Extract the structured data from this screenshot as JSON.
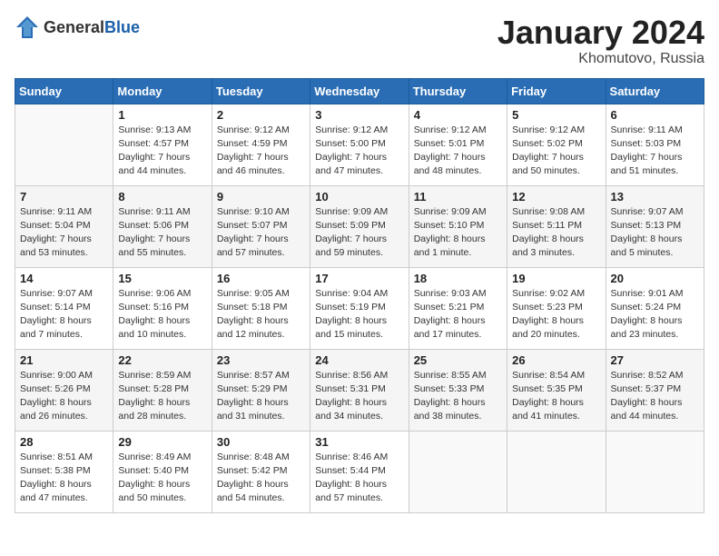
{
  "header": {
    "logo_general": "General",
    "logo_blue": "Blue",
    "title": "January 2024",
    "subtitle": "Khomutovo, Russia"
  },
  "weekdays": [
    "Sunday",
    "Monday",
    "Tuesday",
    "Wednesday",
    "Thursday",
    "Friday",
    "Saturday"
  ],
  "weeks": [
    [
      {
        "day": "",
        "info": ""
      },
      {
        "day": "1",
        "info": "Sunrise: 9:13 AM\nSunset: 4:57 PM\nDaylight: 7 hours\nand 44 minutes."
      },
      {
        "day": "2",
        "info": "Sunrise: 9:12 AM\nSunset: 4:59 PM\nDaylight: 7 hours\nand 46 minutes."
      },
      {
        "day": "3",
        "info": "Sunrise: 9:12 AM\nSunset: 5:00 PM\nDaylight: 7 hours\nand 47 minutes."
      },
      {
        "day": "4",
        "info": "Sunrise: 9:12 AM\nSunset: 5:01 PM\nDaylight: 7 hours\nand 48 minutes."
      },
      {
        "day": "5",
        "info": "Sunrise: 9:12 AM\nSunset: 5:02 PM\nDaylight: 7 hours\nand 50 minutes."
      },
      {
        "day": "6",
        "info": "Sunrise: 9:11 AM\nSunset: 5:03 PM\nDaylight: 7 hours\nand 51 minutes."
      }
    ],
    [
      {
        "day": "7",
        "info": "Sunrise: 9:11 AM\nSunset: 5:04 PM\nDaylight: 7 hours\nand 53 minutes."
      },
      {
        "day": "8",
        "info": "Sunrise: 9:11 AM\nSunset: 5:06 PM\nDaylight: 7 hours\nand 55 minutes."
      },
      {
        "day": "9",
        "info": "Sunrise: 9:10 AM\nSunset: 5:07 PM\nDaylight: 7 hours\nand 57 minutes."
      },
      {
        "day": "10",
        "info": "Sunrise: 9:09 AM\nSunset: 5:09 PM\nDaylight: 7 hours\nand 59 minutes."
      },
      {
        "day": "11",
        "info": "Sunrise: 9:09 AM\nSunset: 5:10 PM\nDaylight: 8 hours\nand 1 minute."
      },
      {
        "day": "12",
        "info": "Sunrise: 9:08 AM\nSunset: 5:11 PM\nDaylight: 8 hours\nand 3 minutes."
      },
      {
        "day": "13",
        "info": "Sunrise: 9:07 AM\nSunset: 5:13 PM\nDaylight: 8 hours\nand 5 minutes."
      }
    ],
    [
      {
        "day": "14",
        "info": "Sunrise: 9:07 AM\nSunset: 5:14 PM\nDaylight: 8 hours\nand 7 minutes."
      },
      {
        "day": "15",
        "info": "Sunrise: 9:06 AM\nSunset: 5:16 PM\nDaylight: 8 hours\nand 10 minutes."
      },
      {
        "day": "16",
        "info": "Sunrise: 9:05 AM\nSunset: 5:18 PM\nDaylight: 8 hours\nand 12 minutes."
      },
      {
        "day": "17",
        "info": "Sunrise: 9:04 AM\nSunset: 5:19 PM\nDaylight: 8 hours\nand 15 minutes."
      },
      {
        "day": "18",
        "info": "Sunrise: 9:03 AM\nSunset: 5:21 PM\nDaylight: 8 hours\nand 17 minutes."
      },
      {
        "day": "19",
        "info": "Sunrise: 9:02 AM\nSunset: 5:23 PM\nDaylight: 8 hours\nand 20 minutes."
      },
      {
        "day": "20",
        "info": "Sunrise: 9:01 AM\nSunset: 5:24 PM\nDaylight: 8 hours\nand 23 minutes."
      }
    ],
    [
      {
        "day": "21",
        "info": "Sunrise: 9:00 AM\nSunset: 5:26 PM\nDaylight: 8 hours\nand 26 minutes."
      },
      {
        "day": "22",
        "info": "Sunrise: 8:59 AM\nSunset: 5:28 PM\nDaylight: 8 hours\nand 28 minutes."
      },
      {
        "day": "23",
        "info": "Sunrise: 8:57 AM\nSunset: 5:29 PM\nDaylight: 8 hours\nand 31 minutes."
      },
      {
        "day": "24",
        "info": "Sunrise: 8:56 AM\nSunset: 5:31 PM\nDaylight: 8 hours\nand 34 minutes."
      },
      {
        "day": "25",
        "info": "Sunrise: 8:55 AM\nSunset: 5:33 PM\nDaylight: 8 hours\nand 38 minutes."
      },
      {
        "day": "26",
        "info": "Sunrise: 8:54 AM\nSunset: 5:35 PM\nDaylight: 8 hours\nand 41 minutes."
      },
      {
        "day": "27",
        "info": "Sunrise: 8:52 AM\nSunset: 5:37 PM\nDaylight: 8 hours\nand 44 minutes."
      }
    ],
    [
      {
        "day": "28",
        "info": "Sunrise: 8:51 AM\nSunset: 5:38 PM\nDaylight: 8 hours\nand 47 minutes."
      },
      {
        "day": "29",
        "info": "Sunrise: 8:49 AM\nSunset: 5:40 PM\nDaylight: 8 hours\nand 50 minutes."
      },
      {
        "day": "30",
        "info": "Sunrise: 8:48 AM\nSunset: 5:42 PM\nDaylight: 8 hours\nand 54 minutes."
      },
      {
        "day": "31",
        "info": "Sunrise: 8:46 AM\nSunset: 5:44 PM\nDaylight: 8 hours\nand 57 minutes."
      },
      {
        "day": "",
        "info": ""
      },
      {
        "day": "",
        "info": ""
      },
      {
        "day": "",
        "info": ""
      }
    ]
  ]
}
